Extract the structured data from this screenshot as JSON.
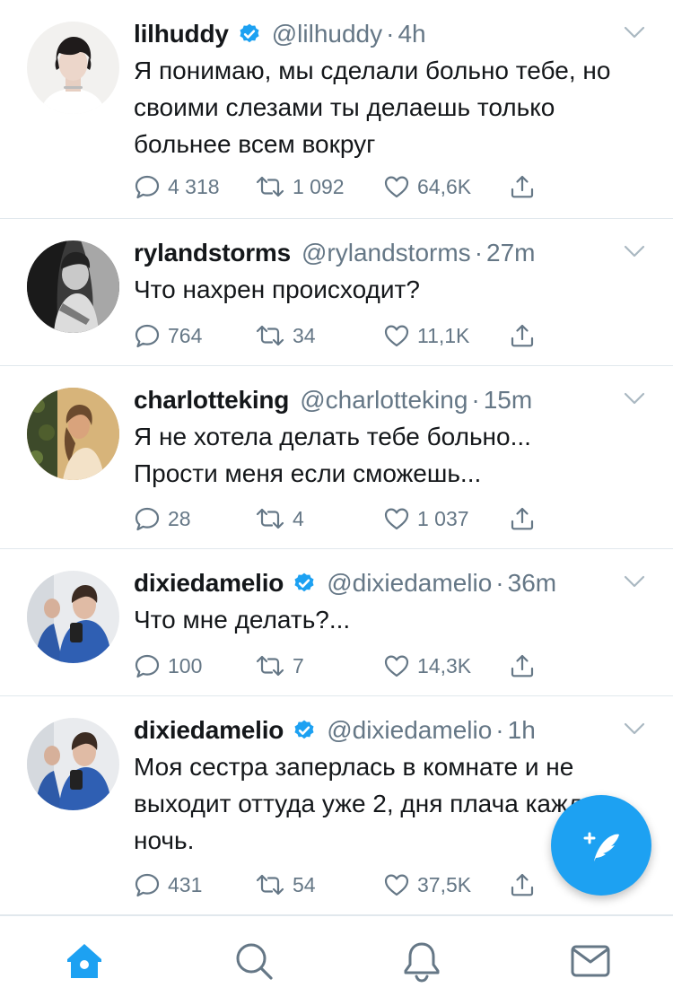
{
  "colors": {
    "accent": "#1da1f2",
    "text": "#14171a",
    "muted": "#657786",
    "divider": "#e1e8ed"
  },
  "tweets": [
    {
      "name": "lilhuddy",
      "verified": true,
      "handle": "@lilhuddy",
      "dot": "·",
      "time": "4h",
      "text": "Я понимаю, мы сделали больно тебе, но своими слезами ты делаешь только больнее всем вокруг",
      "replies": "4 318",
      "retweets": "1 092",
      "likes": "64,6K"
    },
    {
      "name": "rylandstorms",
      "verified": false,
      "handle": "@rylandstorms",
      "dot": "·",
      "time": "27m",
      "text": "Что нахрен происходит?",
      "replies": "764",
      "retweets": "34",
      "likes": "11,1K"
    },
    {
      "name": "charlotteking",
      "verified": false,
      "handle": "@charlotteking",
      "dot": "·",
      "time": "15m",
      "text": "Я не хотела делать тебе больно... Прости меня если сможешь...",
      "replies": "28",
      "retweets": "4",
      "likes": "1 037"
    },
    {
      "name": "dixiedamelio",
      "verified": true,
      "handle": "@dixiedamelio",
      "dot": "·",
      "time": "36m",
      "text": "Что мне делать?...",
      "replies": "100",
      "retweets": "7",
      "likes": "14,3K"
    },
    {
      "name": "dixiedamelio",
      "verified": true,
      "handle": "@dixiedamelio",
      "dot": "·",
      "time": "1h",
      "text": "Моя сестра заперлась в комнате и не выходит оттуда уже 2, дня плача каждую ночь.",
      "replies": "431",
      "retweets": "54",
      "likes": "37,5K"
    }
  ],
  "tabbar": {
    "items": [
      {
        "icon": "home-icon",
        "active": true
      },
      {
        "icon": "search-icon",
        "active": false
      },
      {
        "icon": "notifications-icon",
        "active": false
      },
      {
        "icon": "messages-icon",
        "active": false
      }
    ]
  },
  "fab": {
    "icon": "compose-tweet-icon"
  }
}
